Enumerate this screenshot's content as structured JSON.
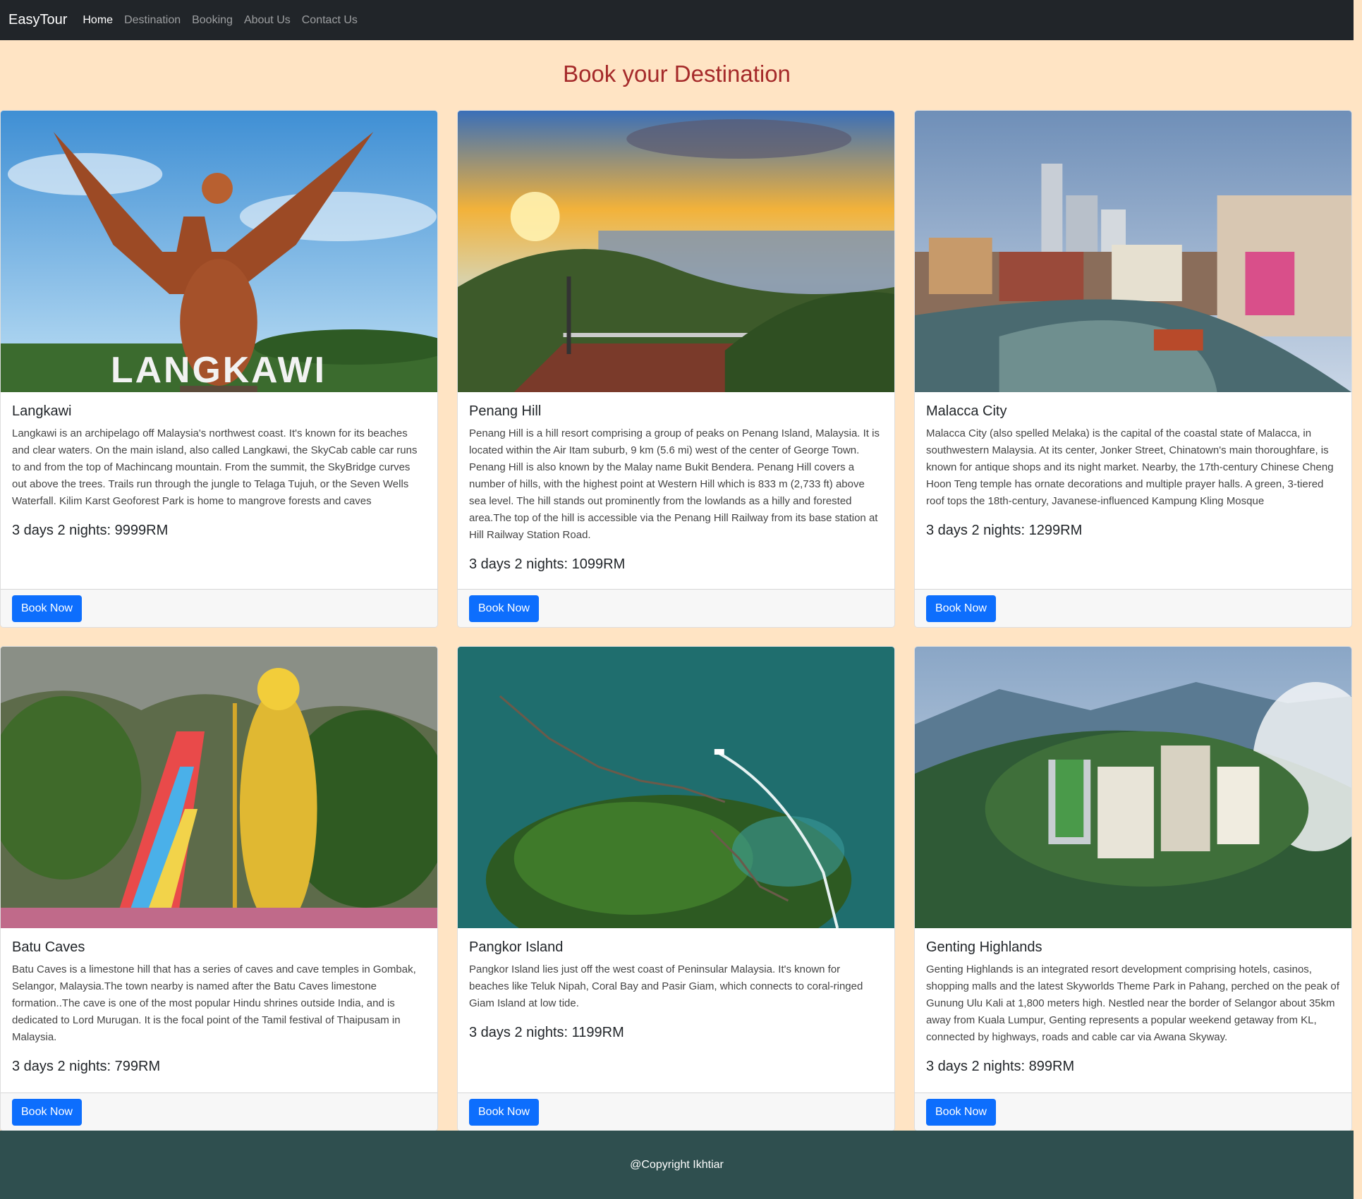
{
  "nav": {
    "brand": "EasyTour",
    "links": [
      "Home",
      "Destination",
      "Booking",
      "About Us",
      "Contact Us"
    ]
  },
  "page": {
    "title": "Book your Destination"
  },
  "cards": [
    {
      "title": "Langkawi",
      "text": "Langkawi is an archipelago off Malaysia's northwest coast. It's known for its beaches and clear waters. On the main island, also called Langkawi, the SkyCab cable car runs to and from the top of Machincang mountain. From the summit, the SkyBridge curves out above the trees. Trails run through the jungle to Telaga Tujuh, or the Seven Wells Waterfall. Kilim Karst Geoforest Park is home to mangrove forests and caves",
      "price": "3 days 2 nights: 9999RM",
      "button": "Book Now",
      "image_label": "LANGKAWI"
    },
    {
      "title": "Penang Hill",
      "text": "Penang Hill is a hill resort comprising a group of peaks on Penang Island, Malaysia. It is located within the Air Itam suburb, 9 km (5.6 mi) west of the center of George Town. Penang Hill is also known by the Malay name Bukit Bendera. Penang Hill covers a number of hills, with the highest point at Western Hill which is 833 m (2,733 ft) above sea level. The hill stands out prominently from the lowlands as a hilly and forested area.The top of the hill is accessible via the Penang Hill Railway from its base station at Hill Railway Station Road.",
      "price": "3 days 2 nights: 1099RM",
      "button": "Book Now"
    },
    {
      "title": "Malacca City",
      "text": "Malacca City (also spelled Melaka) is the capital of the coastal state of Malacca, in southwestern Malaysia. At its center, Jonker Street, Chinatown's main thoroughfare, is known for antique shops and its night market. Nearby, the 17th-century Chinese Cheng Hoon Teng temple has ornate decorations and multiple prayer halls. A green, 3-tiered roof tops the 18th-century, Javanese-influenced Kampung Kling Mosque",
      "price": "3 days 2 nights: 1299RM",
      "button": "Book Now"
    },
    {
      "title": "Batu Caves",
      "text": "Batu Caves is a limestone hill that has a series of caves and cave temples in Gombak, Selangor, Malaysia.The town nearby is named after the Batu Caves limestone formation..The cave is one of the most popular Hindu shrines outside India, and is dedicated to Lord Murugan. It is the focal point of the Tamil festival of Thaipusam in Malaysia.",
      "price": "3 days 2 nights: 799RM",
      "button": "Book Now"
    },
    {
      "title": "Pangkor Island",
      "text": "Pangkor Island lies just off the west coast of Peninsular Malaysia. It's known for beaches like Teluk Nipah, Coral Bay and Pasir Giam, which connects to coral-ringed Giam Island at low tide.",
      "price": "3 days 2 nights: 1199RM",
      "button": "Book Now"
    },
    {
      "title": "Genting Highlands",
      "text": "Genting Highlands is an integrated resort development comprising hotels, casinos, shopping malls and the latest Skyworlds Theme Park in Pahang, perched on the peak of Gunung Ulu Kali at 1,800 meters high. Nestled near the border of Selangor about 35km away from Kuala Lumpur, Genting represents a popular weekend getaway from KL, connected by highways, roads and cable car via Awana Skyway.",
      "price": "3 days 2 nights: 899RM",
      "button": "Book Now"
    }
  ],
  "footer": {
    "text": "@Copyright Ikhtiar"
  },
  "colors": {
    "navbar": "#212529",
    "background": "#ffe4c4",
    "title": "#a52a2a",
    "button": "#0d6efd",
    "footer": "#2f4f4f"
  }
}
